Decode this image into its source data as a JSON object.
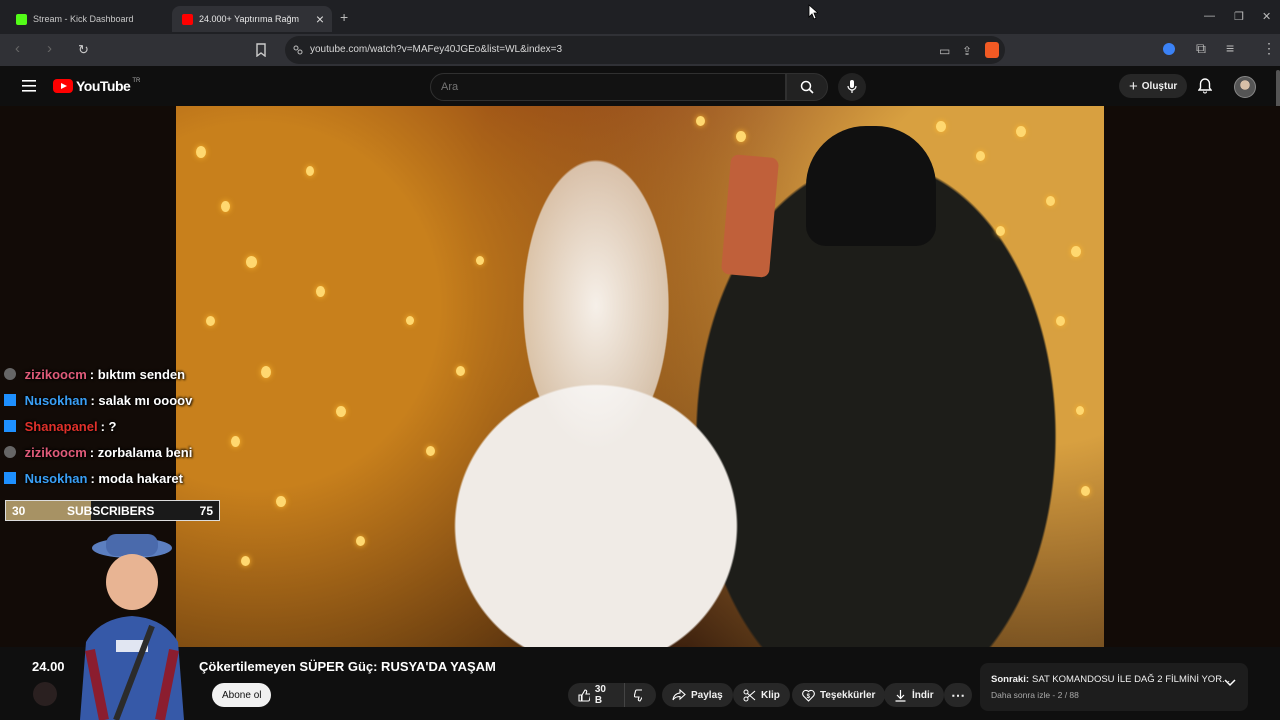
{
  "browser": {
    "tabs": [
      {
        "label": "Stream - Kick Dashboard",
        "favicon": "kick-icon",
        "active": false
      },
      {
        "label": "24.000+ Yaptırıma Rağmen",
        "favicon": "youtube-icon",
        "active": true
      }
    ],
    "url": "youtube.com/watch?v=MAFey40JGEo&list=WL&index=3"
  },
  "youtube": {
    "logo_text": "YouTube",
    "logo_region": "TR",
    "search_placeholder": "Ara",
    "create_label": "Oluştur"
  },
  "chat": {
    "messages": [
      {
        "user": "zizikoocm",
        "message": ": bıktım senden",
        "color": "#e05b79",
        "badge": "user-badge-icon"
      },
      {
        "user": "Nusokhan",
        "message": ": salak mı oooov",
        "color": "#3a9ff5",
        "badge": "bot-badge-icon"
      },
      {
        "user": "Shanapanel",
        "message": ": ?",
        "color": "#e0312a",
        "badge": "bot-badge-icon"
      },
      {
        "user": "zizikoocm",
        "message": ": zorbalama beni",
        "color": "#e05b79",
        "badge": "user-badge-icon"
      },
      {
        "user": "Nusokhan",
        "message": ": moda hakaret",
        "color": "#3a9ff5",
        "badge": "bot-badge-icon"
      }
    ],
    "subscriber_goal": {
      "current": "30",
      "label": "SUBSCRIBERS",
      "target": "75",
      "progress": 0.4
    }
  },
  "video": {
    "title_prefix": "24.00",
    "title": "Çökertilemeyen SÜPER Güç: RUSYA'DA YAŞAM",
    "subscribe_label": "Abone ol",
    "likes": "30 B",
    "share_label": "Paylaş",
    "clip_label": "Klip",
    "thanks_label": "Teşekkürler",
    "download_label": "İndir"
  },
  "up_next": {
    "prefix": "Sonraki:",
    "title": "SAT KOMANDOSU İLE DAĞ 2 FİLMİNİ YOR...",
    "subtitle": "Daha sonra izle - 2 / 88"
  }
}
